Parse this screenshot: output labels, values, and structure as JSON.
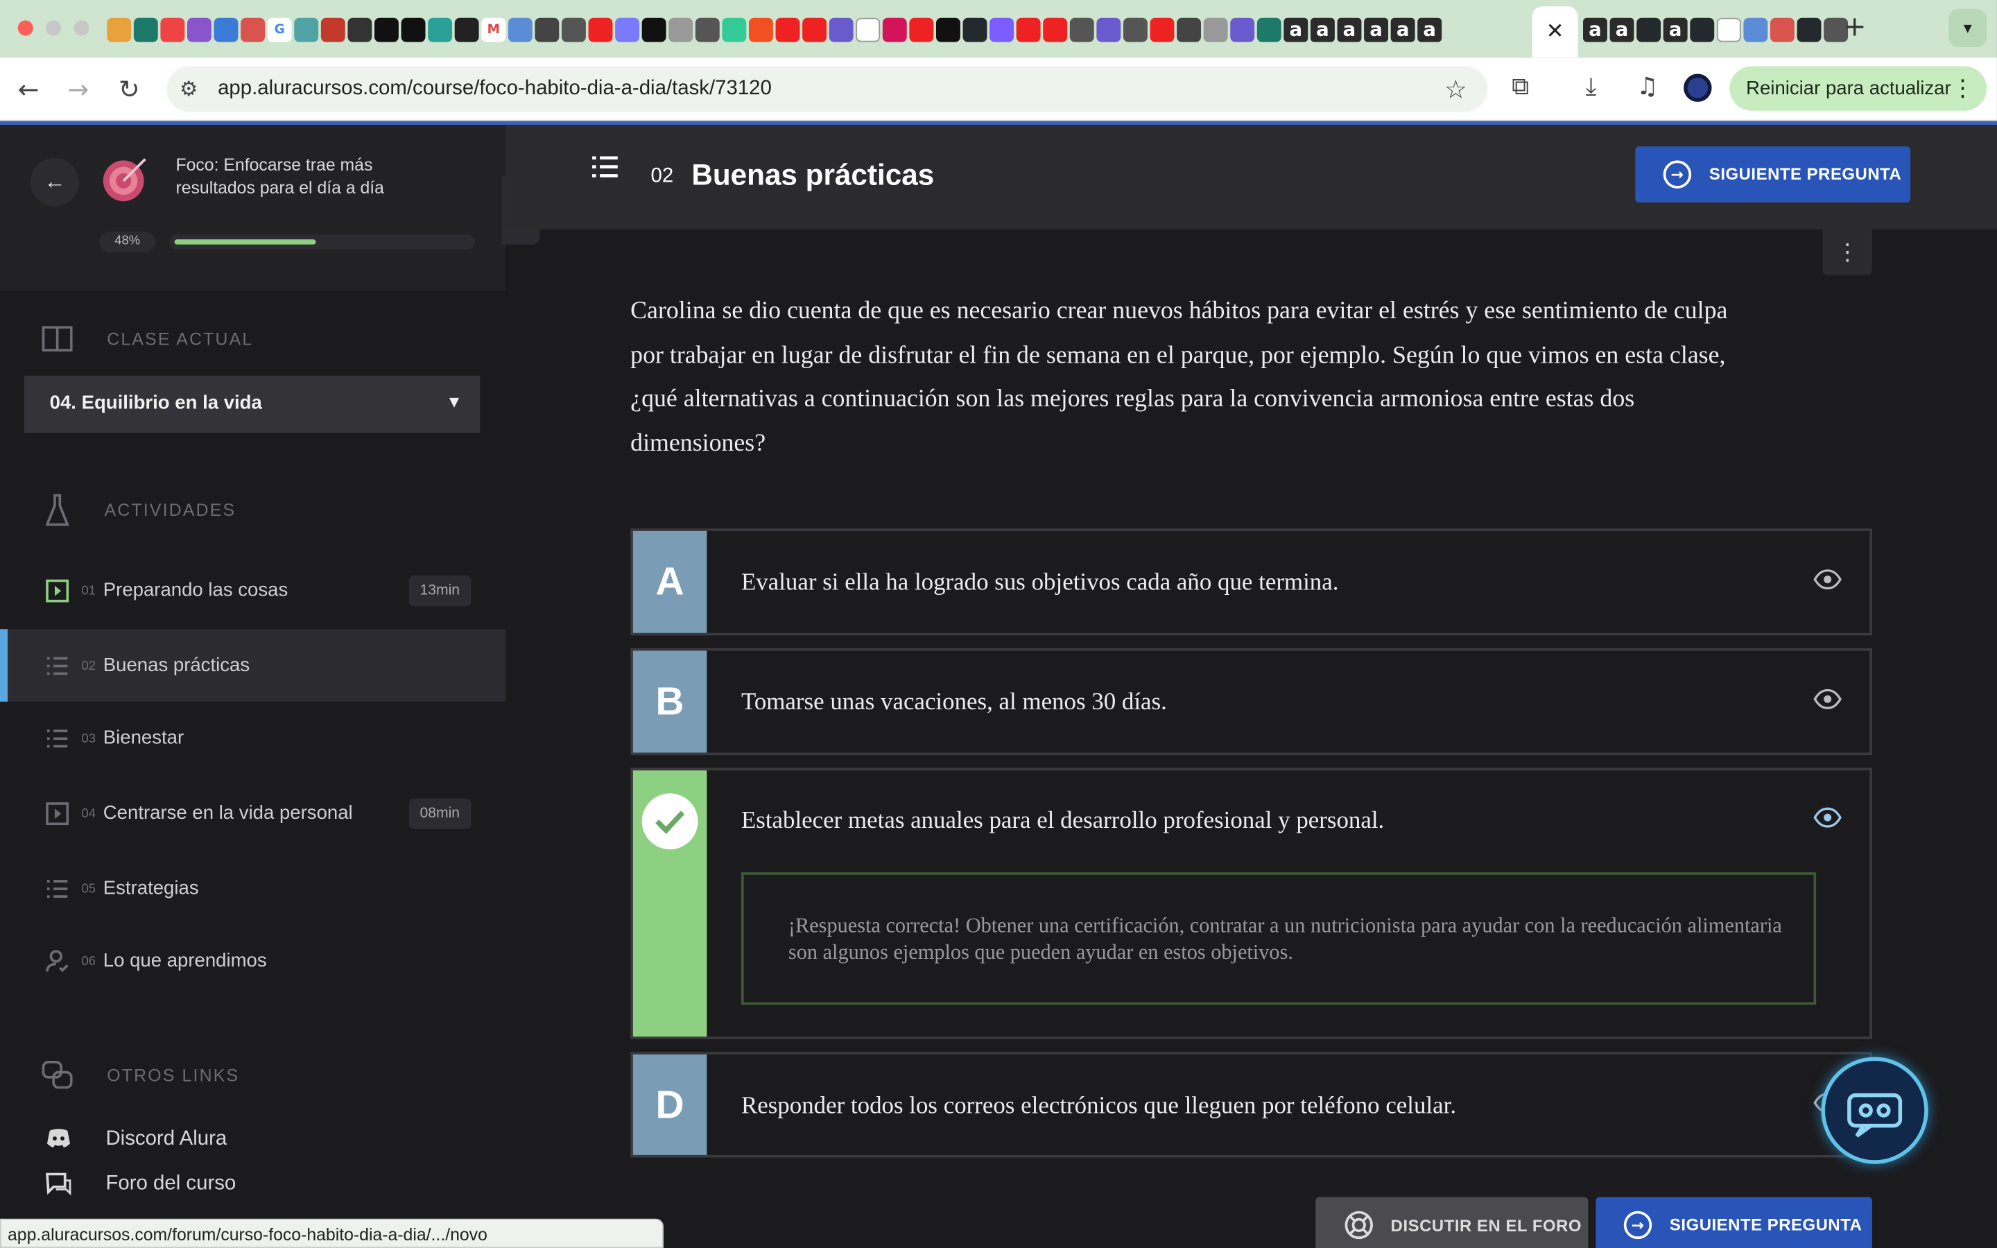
{
  "browser": {
    "url": "app.aluracursos.com/course/foco-habito-dia-a-dia/task/73120",
    "update_button": "Reiniciar para actualizar",
    "status_url": "app.aluracursos.com/forum/curso-foco-habito-dia-a-dia/.../novo",
    "favicon_letters": [
      "G",
      "f",
      "M",
      "a",
      "a",
      "a",
      "a",
      "a",
      "a",
      "a",
      "a",
      "a",
      "a"
    ],
    "active_tab_close": "✕"
  },
  "sidebar": {
    "course_title": "Foco: Enfocarse trae más resultados para el día a día",
    "progress_label": "48%",
    "progress_value": 0.48,
    "current_class_label": "CLASE ACTUAL",
    "current_class": "04. Equilibrio en la vida",
    "activities_label": "ACTIVIDADES",
    "activities": [
      {
        "num": "01",
        "label": "Preparando las cosas",
        "duration": "13min",
        "type": "video-done"
      },
      {
        "num": "02",
        "label": "Buenas prácticas",
        "duration": "",
        "type": "list",
        "active": true
      },
      {
        "num": "03",
        "label": "Bienestar",
        "duration": "",
        "type": "list"
      },
      {
        "num": "04",
        "label": "Centrarse en la vida personal",
        "duration": "08min",
        "type": "video"
      },
      {
        "num": "05",
        "label": "Estrategias",
        "duration": "",
        "type": "list"
      },
      {
        "num": "06",
        "label": "Lo que aprendimos",
        "duration": "",
        "type": "person"
      }
    ],
    "other_links_label": "OTROS LINKS",
    "links": [
      {
        "label": "Discord Alura",
        "icon": "discord-icon"
      },
      {
        "label": "Foro del curso",
        "icon": "chat-icon"
      }
    ]
  },
  "task": {
    "number": "02",
    "title": "Buenas prácticas",
    "next_label": "SIGUIENTE PREGUNTA",
    "question": "Carolina se dio cuenta de que es necesario crear nuevos hábitos para evitar el estrés y ese sentimiento de culpa por trabajar en lugar de disfrutar el fin de semana en el parque, por ejemplo. Según lo que vimos en esta clase, ¿qué alternativas a continuación son las mejores reglas para la convivencia armoniosa entre estas dos dimensiones?",
    "alternatives": [
      {
        "letter": "A",
        "text": "Evaluar si ella ha logrado sus objetivos cada año que termina.",
        "correct": false
      },
      {
        "letter": "B",
        "text": "Tomarse unas vacaciones, al menos 30 días.",
        "correct": false
      },
      {
        "letter": "C",
        "text": "Establecer metas anuales para el desarrollo profesional y personal.",
        "correct": true,
        "feedback": "¡Respuesta correcta! Obtener una certificación, contratar a un nutricionista para ayudar con la reeducación alimentaria son algunos ejemplos que pueden ayudar en estos objetivos."
      },
      {
        "letter": "D",
        "text": "Responder todos los correos electrónicos que lleguen por teléfono celular.",
        "correct": false
      }
    ],
    "forum_label": "DISCUTIR EN EL FORO",
    "bottom_next_label": "SIGUIENTE PREGUNTA"
  },
  "colors": {
    "accent_blue": "#2a55b8",
    "correct_green": "#8ed081",
    "letter_blue": "#7b9cb5",
    "active_marker": "#5aa6e0"
  }
}
